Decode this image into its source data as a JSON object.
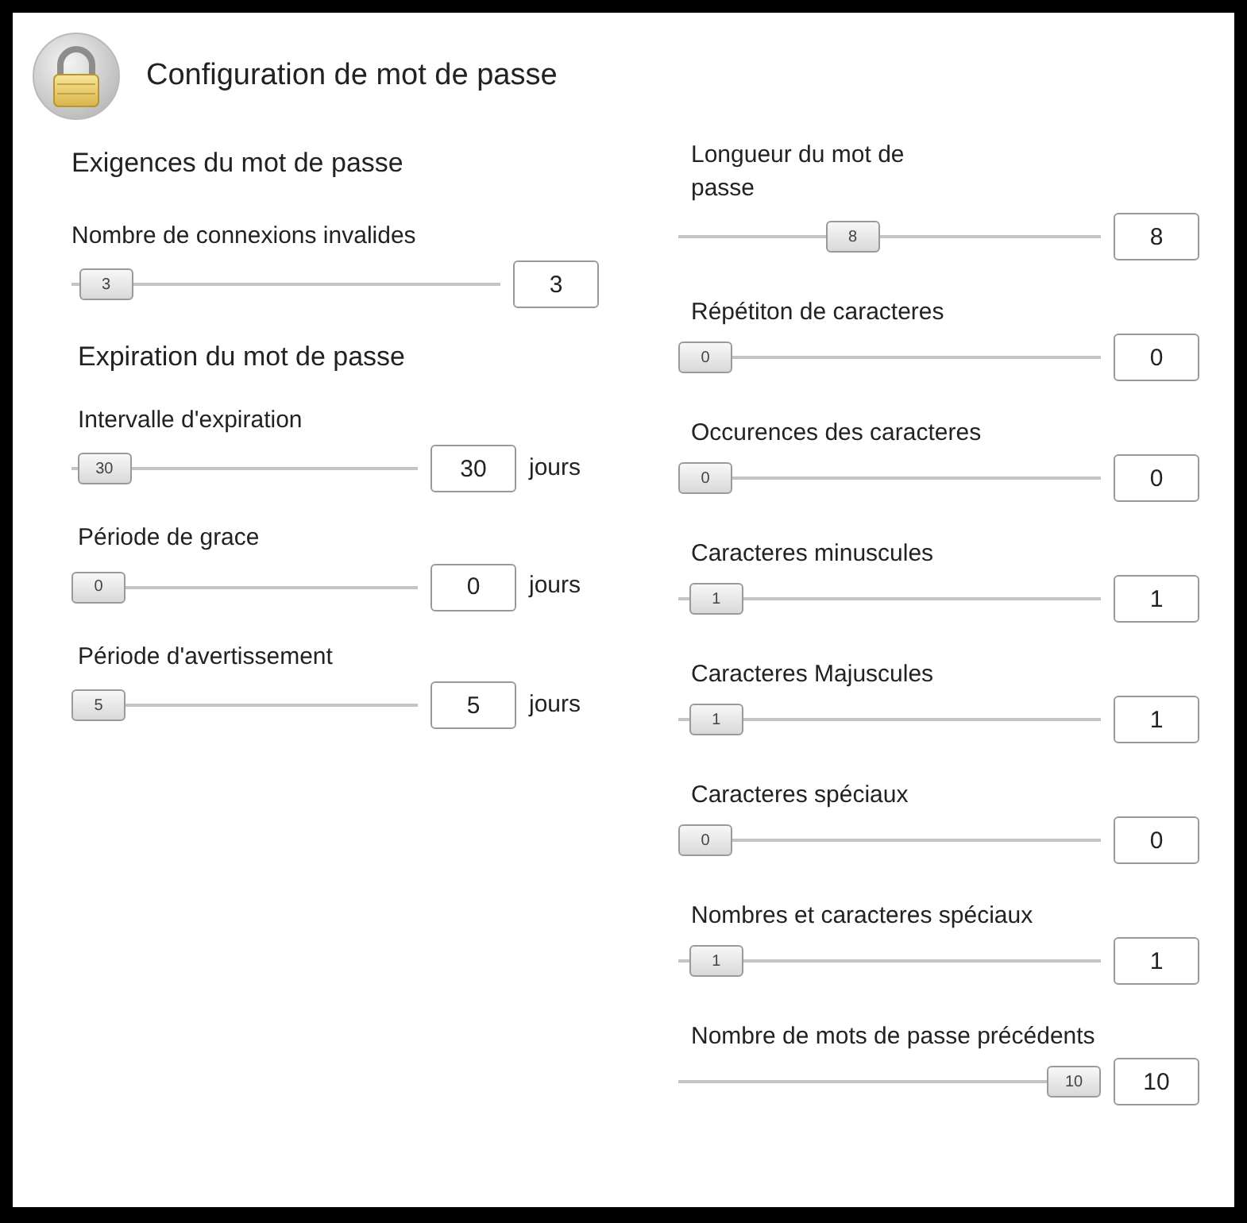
{
  "title": "Configuration de mot de passe",
  "left_sections": [
    {
      "heading": "Exigences du mot de passe",
      "settings": [
        {
          "label": "Nombre de connexions invalides",
          "thumb": "3",
          "level": 0.02,
          "value": "3"
        }
      ]
    },
    {
      "heading": "Expiration du mot de passe",
      "settings": [
        {
          "label": "Intervalle d'expiration",
          "thumb": "30",
          "level": 0.02,
          "value": "30",
          "unit": "jours"
        },
        {
          "label": "Période de grace",
          "thumb": "0",
          "level": 0,
          "value": "0",
          "unit": "jours"
        },
        {
          "label": "Période d'avertissement",
          "thumb": "5",
          "level": 0,
          "value": "5",
          "unit": "jours"
        }
      ]
    }
  ],
  "right_settings": [
    {
      "label": "Longueur du mot de passe",
      "thumb": "8",
      "level": 0.4,
      "value": "8"
    },
    {
      "label": "Répétiton de caracteres",
      "thumb": "0",
      "level": 0,
      "value": "0"
    },
    {
      "label": "Occurences des caracteres",
      "thumb": "0",
      "level": 0,
      "value": "0"
    },
    {
      "label": "Caracteres minuscules",
      "thumb": "1",
      "level": 0.03,
      "value": "1"
    },
    {
      "label": "Caracteres Majuscules",
      "thumb": "1",
      "level": 0.03,
      "value": "1"
    },
    {
      "label": "Caracteres spéciaux",
      "thumb": "0",
      "level": 0,
      "value": "0"
    },
    {
      "label": "Nombres et caracteres spéciaux",
      "thumb": "1",
      "level": 0.03,
      "value": "1"
    },
    {
      "label": "Nombre de mots de passe précédents",
      "thumb": "10",
      "level": 1,
      "value": "10"
    }
  ]
}
